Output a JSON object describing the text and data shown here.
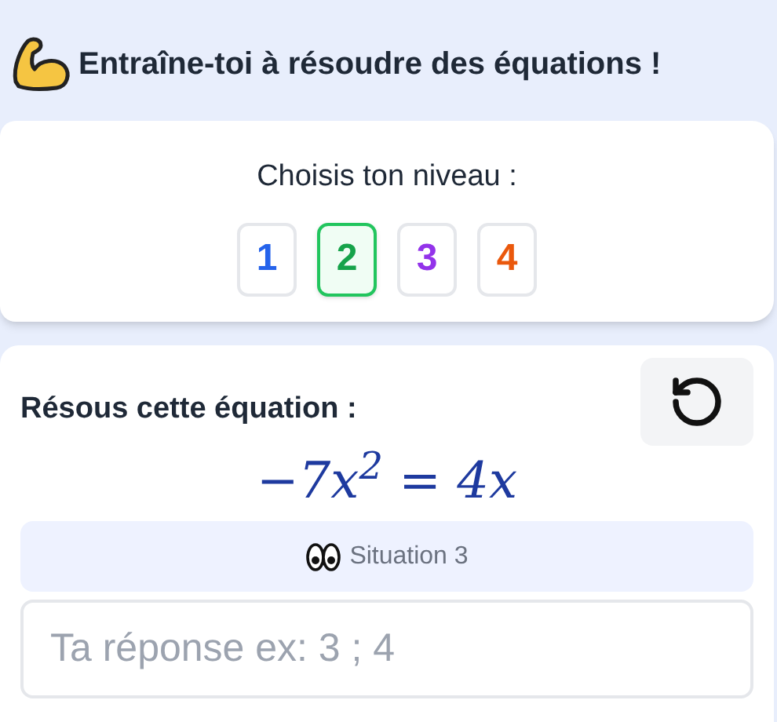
{
  "header": {
    "title": "Entraîne-toi à résoudre des équations !"
  },
  "level_card": {
    "title": "Choisis ton niveau :",
    "levels": [
      {
        "label": "1",
        "color": "#2563eb",
        "selected": false
      },
      {
        "label": "2",
        "color": "#16a34a",
        "selected": true
      },
      {
        "label": "3",
        "color": "#9333ea",
        "selected": false
      },
      {
        "label": "4",
        "color": "#ea580c",
        "selected": false
      }
    ]
  },
  "exercise_card": {
    "title": "Résous cette équation :",
    "equation": "−7x$^{2}$ = 4x",
    "situation": "Situation 3",
    "answer": {
      "placeholder": "Ta réponse ex: 3 ; 4"
    }
  }
}
